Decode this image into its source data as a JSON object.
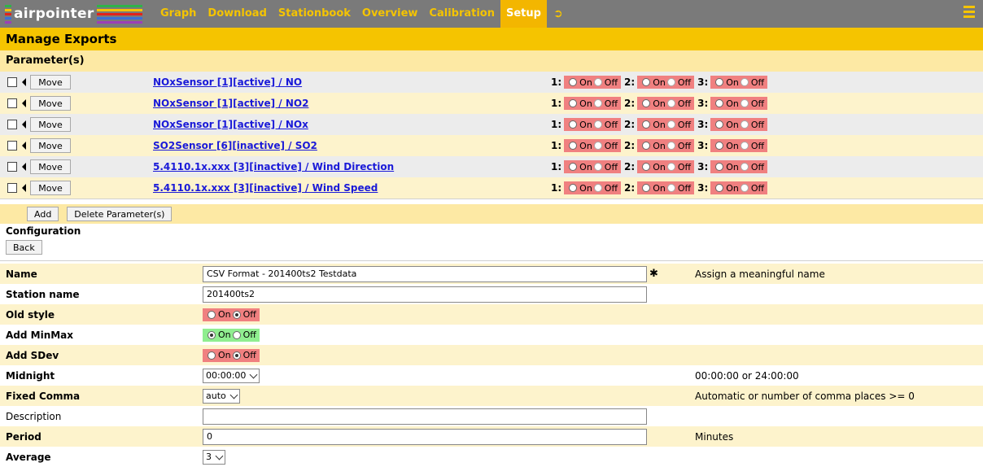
{
  "nav": {
    "logo": "airpointer",
    "items": [
      "Graph",
      "Download",
      "Stationbook",
      "Overview",
      "Calibration",
      "Setup"
    ],
    "active": "Setup",
    "logout_icon": "sign-out-icon",
    "menu_icon": "hamburger-icon"
  },
  "page": {
    "title": "Manage Exports",
    "parameters_header": "Parameter(s)"
  },
  "parameters": [
    {
      "link": "NOxSensor [1][active] / NO",
      "move": "Move"
    },
    {
      "link": "NOxSensor [1][active] / NO2",
      "move": "Move"
    },
    {
      "link": "NOxSensor [1][active] / NOx",
      "move": "Move"
    },
    {
      "link": "SO2Sensor [6][inactive] / SO2",
      "move": "Move"
    },
    {
      "link": "5.4110.1x.xxx [3][inactive] / Wind Direction",
      "move": "Move"
    },
    {
      "link": "5.4110.1x.xxx [3][inactive] / Wind Speed",
      "move": "Move"
    }
  ],
  "channels": {
    "labels": [
      "1:",
      "2:",
      "3:"
    ],
    "on": "On",
    "off": "Off"
  },
  "actions": {
    "add": "Add",
    "delete": "Delete Parameter(s)"
  },
  "config": {
    "label": "Configuration",
    "back": "Back",
    "required_mark": "✱",
    "fields": {
      "name": {
        "label": "Name",
        "value": "CSV Format - 201400ts2 Testdata",
        "hint": "Assign a meaningful name"
      },
      "station": {
        "label": "Station name",
        "value": "201400ts2"
      },
      "old_style": {
        "label": "Old style",
        "on": "On",
        "off": "Off",
        "selected": "Off"
      },
      "add_minmax": {
        "label": "Add MinMax",
        "on": "On",
        "off": "Off",
        "selected": "On"
      },
      "add_sdev": {
        "label": "Add SDev",
        "on": "On",
        "off": "Off",
        "selected": "Off"
      },
      "midnight": {
        "label": "Midnight",
        "value": "00:00:00",
        "hint": "00:00:00 or 24:00:00"
      },
      "fixed_comma": {
        "label": "Fixed Comma",
        "value": "auto",
        "hint": "Automatic or number of comma places >= 0"
      },
      "description": {
        "label": "Description",
        "value": ""
      },
      "period": {
        "label": "Period",
        "value": "0",
        "hint": "Minutes"
      },
      "average": {
        "label": "Average",
        "value": "3"
      }
    }
  },
  "colors": {
    "topbar": "#7a7a7a",
    "accent": "#f5c400",
    "toggle_off": "#f08080",
    "toggle_on": "#90ee90",
    "link": "#1a1ad8"
  }
}
